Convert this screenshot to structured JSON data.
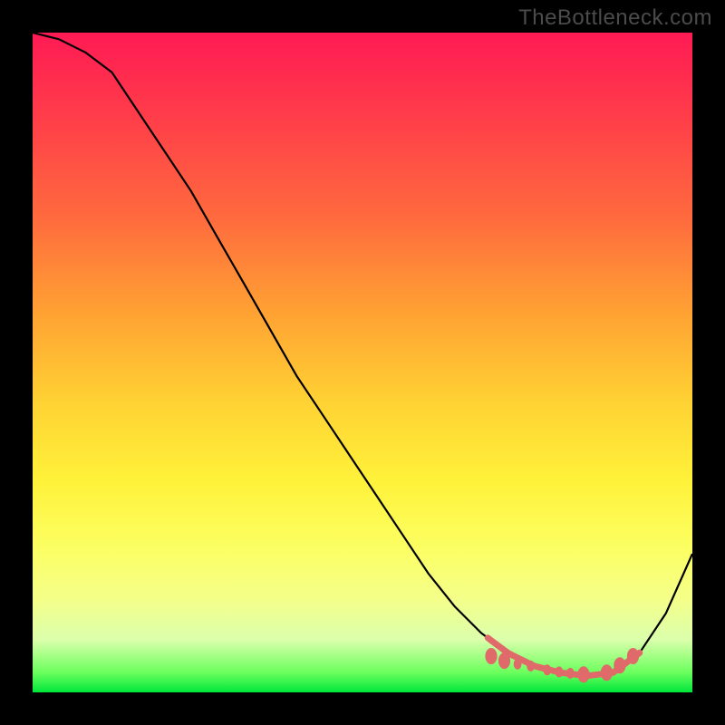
{
  "watermark": "TheBottleneck.com",
  "chart_data": {
    "type": "line",
    "title": "",
    "xlabel": "",
    "ylabel": "",
    "x": [
      0.0,
      0.04,
      0.08,
      0.12,
      0.16,
      0.2,
      0.24,
      0.28,
      0.32,
      0.36,
      0.4,
      0.44,
      0.48,
      0.52,
      0.56,
      0.6,
      0.64,
      0.68,
      0.72,
      0.76,
      0.8,
      0.84,
      0.88,
      0.92,
      0.96,
      1.0
    ],
    "values": [
      1.0,
      0.99,
      0.97,
      0.94,
      0.88,
      0.82,
      0.76,
      0.69,
      0.62,
      0.55,
      0.48,
      0.42,
      0.36,
      0.3,
      0.24,
      0.18,
      0.13,
      0.09,
      0.06,
      0.04,
      0.03,
      0.025,
      0.03,
      0.06,
      0.12,
      0.21
    ],
    "xlim": [
      0,
      1
    ],
    "ylim": [
      0,
      1
    ],
    "bead_region_x": [
      0.69,
      0.92
    ],
    "bead_points": [
      {
        "x": 0.695,
        "y": 0.055,
        "r": 6
      },
      {
        "x": 0.715,
        "y": 0.048,
        "r": 6
      },
      {
        "x": 0.735,
        "y": 0.043,
        "r": 4
      },
      {
        "x": 0.755,
        "y": 0.04,
        "r": 4
      },
      {
        "x": 0.78,
        "y": 0.034,
        "r": 4
      },
      {
        "x": 0.798,
        "y": 0.031,
        "r": 4
      },
      {
        "x": 0.815,
        "y": 0.029,
        "r": 4
      },
      {
        "x": 0.835,
        "y": 0.027,
        "r": 6
      },
      {
        "x": 0.87,
        "y": 0.03,
        "r": 6
      },
      {
        "x": 0.89,
        "y": 0.041,
        "r": 6
      },
      {
        "x": 0.91,
        "y": 0.055,
        "r": 6
      }
    ],
    "colors": {
      "curve": "#000000",
      "beads": "#e06a6a",
      "gradient_top": "#ff1a54",
      "gradient_bottom": "#00e63a",
      "background_frame": "#000000",
      "watermark": "#4b4b4b"
    }
  }
}
